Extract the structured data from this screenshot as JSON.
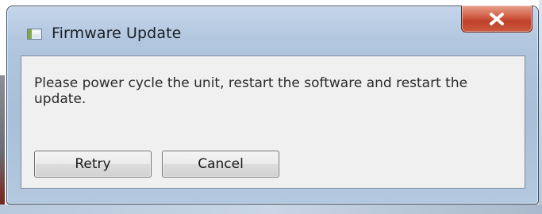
{
  "window": {
    "title": "Firmware Update",
    "close_glyph": "x"
  },
  "message": "Please power cycle the unit, restart the software and restart the update.",
  "buttons": {
    "retry": "Retry",
    "cancel": "Cancel"
  },
  "colors": {
    "frame": "#a9bfd9",
    "close_button": "#c0402a",
    "client_area": "#f0f0f0"
  },
  "icons": {
    "title": "app-window-icon",
    "close": "close-icon"
  }
}
